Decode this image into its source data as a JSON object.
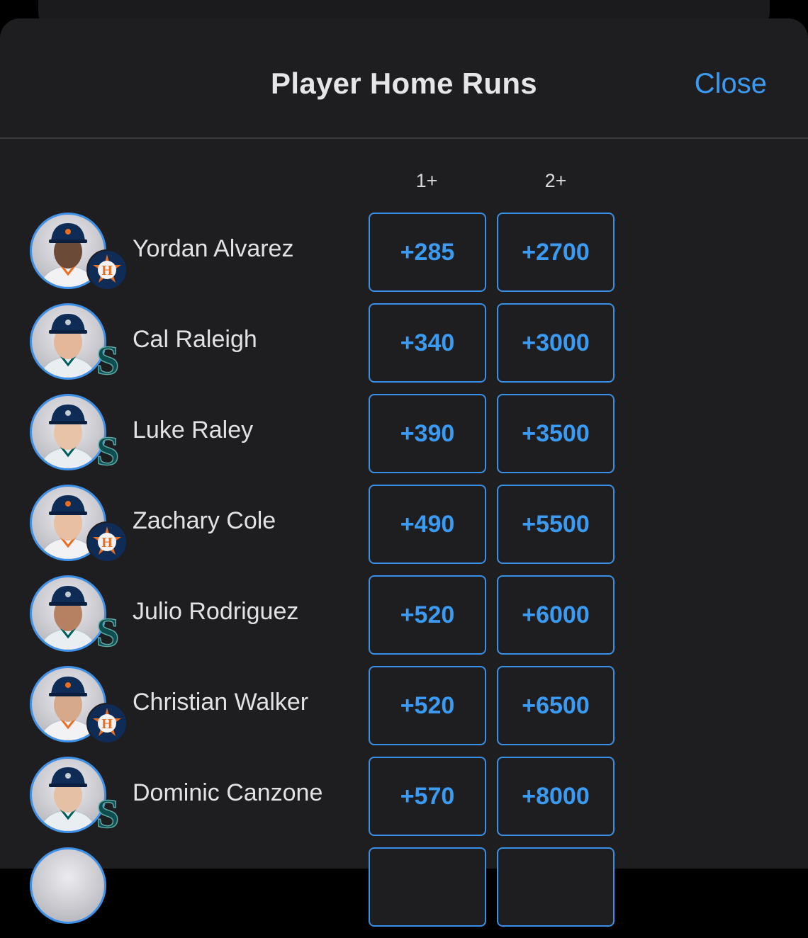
{
  "header": {
    "title": "Player Home Runs",
    "close_label": "Close"
  },
  "columns": [
    "1+",
    "2+"
  ],
  "players": [
    {
      "name": "Yordan Alvarez",
      "team": "astros",
      "odds": [
        "+285",
        "+2700"
      ]
    },
    {
      "name": "Cal Raleigh",
      "team": "mariners",
      "odds": [
        "+340",
        "+3000"
      ]
    },
    {
      "name": "Luke Raley",
      "team": "mariners",
      "odds": [
        "+390",
        "+3500"
      ]
    },
    {
      "name": "Zachary Cole",
      "team": "astros",
      "odds": [
        "+490",
        "+5500"
      ]
    },
    {
      "name": "Julio Rodriguez",
      "team": "mariners",
      "odds": [
        "+520",
        "+6000"
      ]
    },
    {
      "name": "Christian Walker",
      "team": "astros",
      "odds": [
        "+520",
        "+6500"
      ]
    },
    {
      "name": "Dominic Canzone",
      "team": "mariners",
      "odds": [
        "+570",
        "+8000"
      ]
    }
  ],
  "colors": {
    "accent": "#3b9bf2",
    "background": "#1e1e20",
    "astros_navy": "#0f2c57",
    "astros_orange": "#eb6e1f",
    "mariners_teal": "#005c5c"
  }
}
